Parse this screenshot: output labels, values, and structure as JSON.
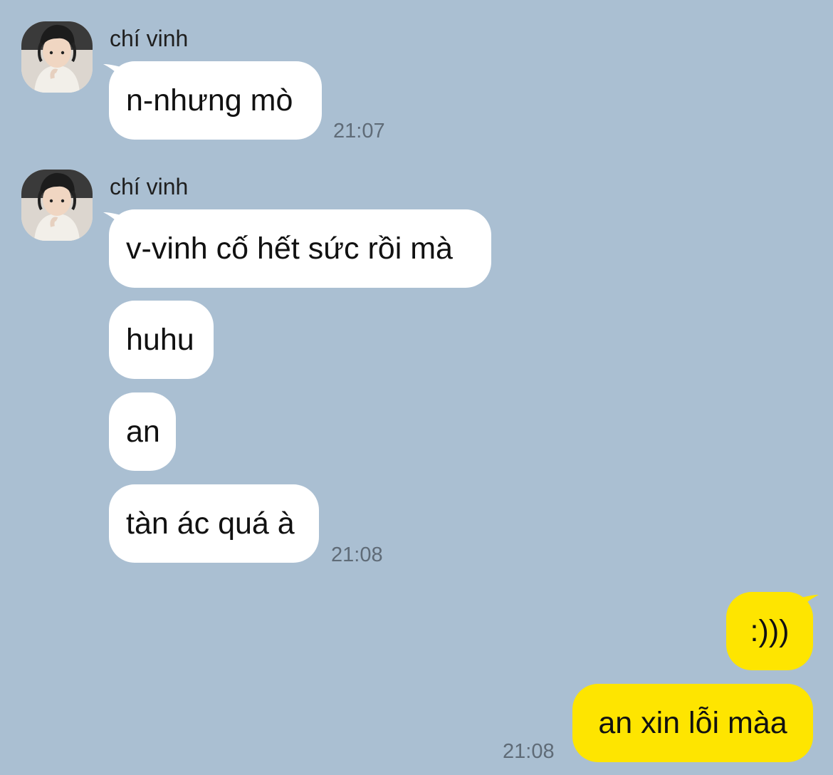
{
  "colors": {
    "background": "#aabfd2",
    "incoming_bubble": "#ffffff",
    "outgoing_bubble": "#fee500",
    "timestamp": "#5f6b77"
  },
  "groups": [
    {
      "sender": "chí vinh",
      "avatar": "profile-photo",
      "messages": [
        "n-nhưng mò"
      ],
      "time": "21:07"
    },
    {
      "sender": "chí vinh",
      "avatar": "profile-photo",
      "messages": [
        "v-vinh cố hết sức rồi mà",
        "huhu",
        "an",
        "tàn ác quá à"
      ],
      "time": "21:08"
    }
  ],
  "outgoing": {
    "messages": [
      ":)))",
      "an xin lỗi màa"
    ],
    "time": "21:08"
  }
}
